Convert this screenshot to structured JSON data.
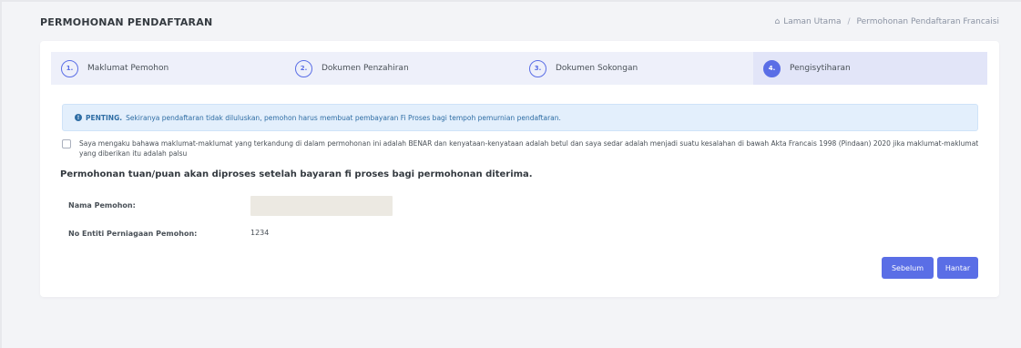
{
  "header": {
    "title": "PERMOHONAN PENDAFTARAN",
    "breadcrumb": {
      "home_icon": "home-icon",
      "home": "Laman Utama",
      "separator": "/",
      "current": "Permohonan Pendaftaran Francaisi"
    }
  },
  "stepper": {
    "steps": [
      {
        "number": "1.",
        "label": "Maklumat Pemohon",
        "active": false
      },
      {
        "number": "2.",
        "label": "Dokumen Penzahiran",
        "active": false
      },
      {
        "number": "3.",
        "label": "Dokumen Sokongan",
        "active": false
      },
      {
        "number": "4.",
        "label": "Pengisytiharan",
        "active": true
      }
    ]
  },
  "alert": {
    "icon": "info-icon",
    "strong": "PENTING.",
    "text": "Sekiranya pendaftaran tidak diluluskan, pemohon harus membuat pembayaran Fi Proses bagi tempoh pemurnian pendaftaran."
  },
  "declaration": {
    "checked": false,
    "text": "Saya mengaku bahawa maklumat-maklumat yang terkandung di dalam permohonan ini adalah BENAR dan kenyataan-kenyataan adalah betul dan saya sedar adalah menjadi suatu kesalahan di bawah Akta Francais 1998 (Pindaan) 2020 jika maklumat-maklumat yang diberikan itu adalah palsu"
  },
  "subtitle": "Permohonan tuan/puan akan diproses setelah bayaran fi proses bagi permohonan diterima.",
  "fields": {
    "name_label": "Nama Pemohon:",
    "name_value": "",
    "entity_label": "No Entiti Perniagaan Pemohon:",
    "entity_value": "1234"
  },
  "buttons": {
    "previous": "Sebelum",
    "submit": "Hantar"
  },
  "colors": {
    "primary": "#5a6ee6",
    "alert_bg": "#e3effc",
    "alert_text": "#2e6da4",
    "stepper_bg": "#eef0fa"
  }
}
